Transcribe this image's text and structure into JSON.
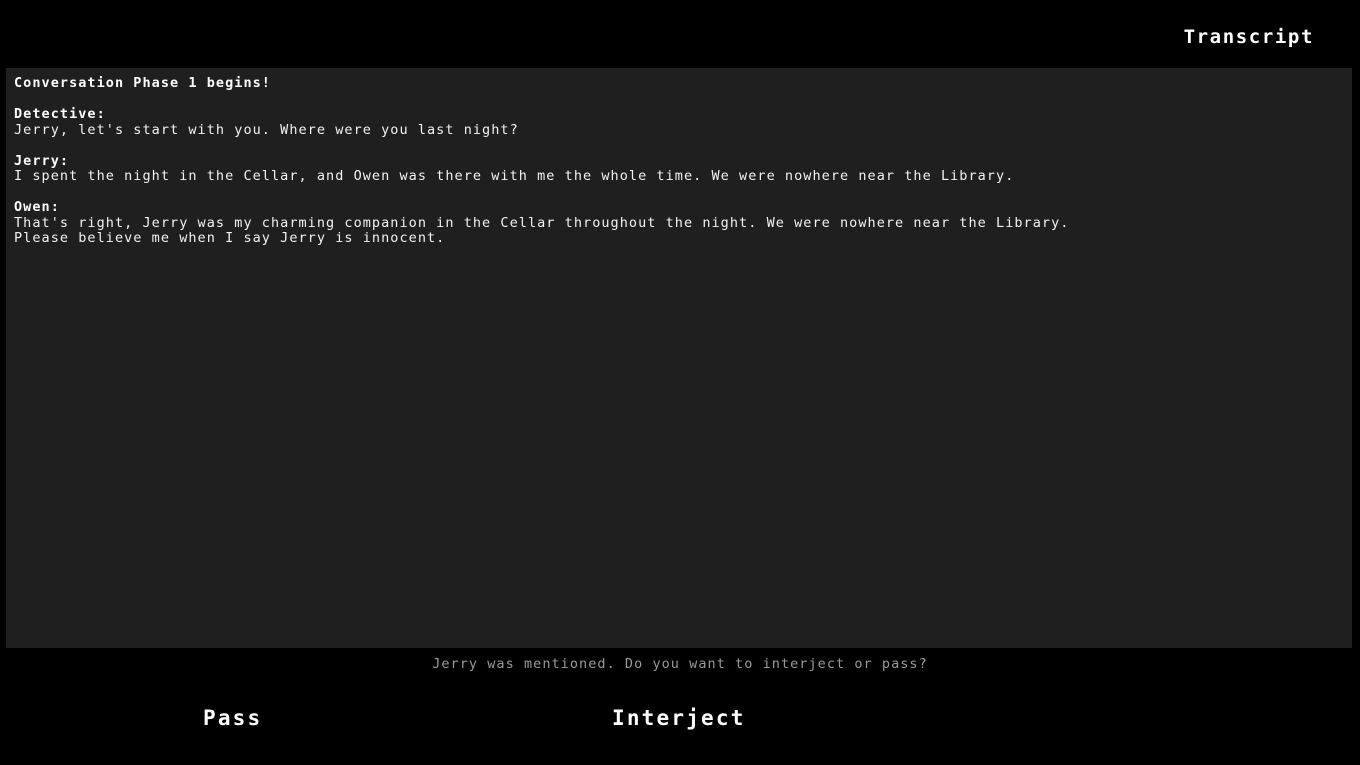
{
  "header": {
    "title": "Transcript"
  },
  "transcript": {
    "lines": [
      {
        "text": "Conversation Phase 1 begins!",
        "style": "system"
      },
      {
        "text": "",
        "style": "blank"
      },
      {
        "text": "Detective:",
        "style": "speaker"
      },
      {
        "text": "Jerry, let's start with you. Where were you last night?",
        "style": "dialogue"
      },
      {
        "text": "",
        "style": "blank"
      },
      {
        "text": "Jerry:",
        "style": "speaker"
      },
      {
        "text": "I spent the night in the Cellar, and Owen was there with me the whole time. We were nowhere near the Library.",
        "style": "dialogue"
      },
      {
        "text": "",
        "style": "blank"
      },
      {
        "text": "Owen:",
        "style": "speaker"
      },
      {
        "text": "That's right, Jerry was my charming companion in the Cellar throughout the night. We were nowhere near the Library.",
        "style": "dialogue"
      },
      {
        "text": "Please believe me when I say Jerry is innocent.",
        "style": "dialogue"
      }
    ]
  },
  "prompt": {
    "text": "Jerry was mentioned. Do you want to interject or pass?"
  },
  "choices": {
    "pass_label": "Pass",
    "interject_label": "Interject"
  },
  "colors": {
    "background": "#000000",
    "panel": "#1f1f1f",
    "text_bright": "#ffffff",
    "text_body": "#f2f2f2",
    "text_dim": "#9a9a9a"
  }
}
